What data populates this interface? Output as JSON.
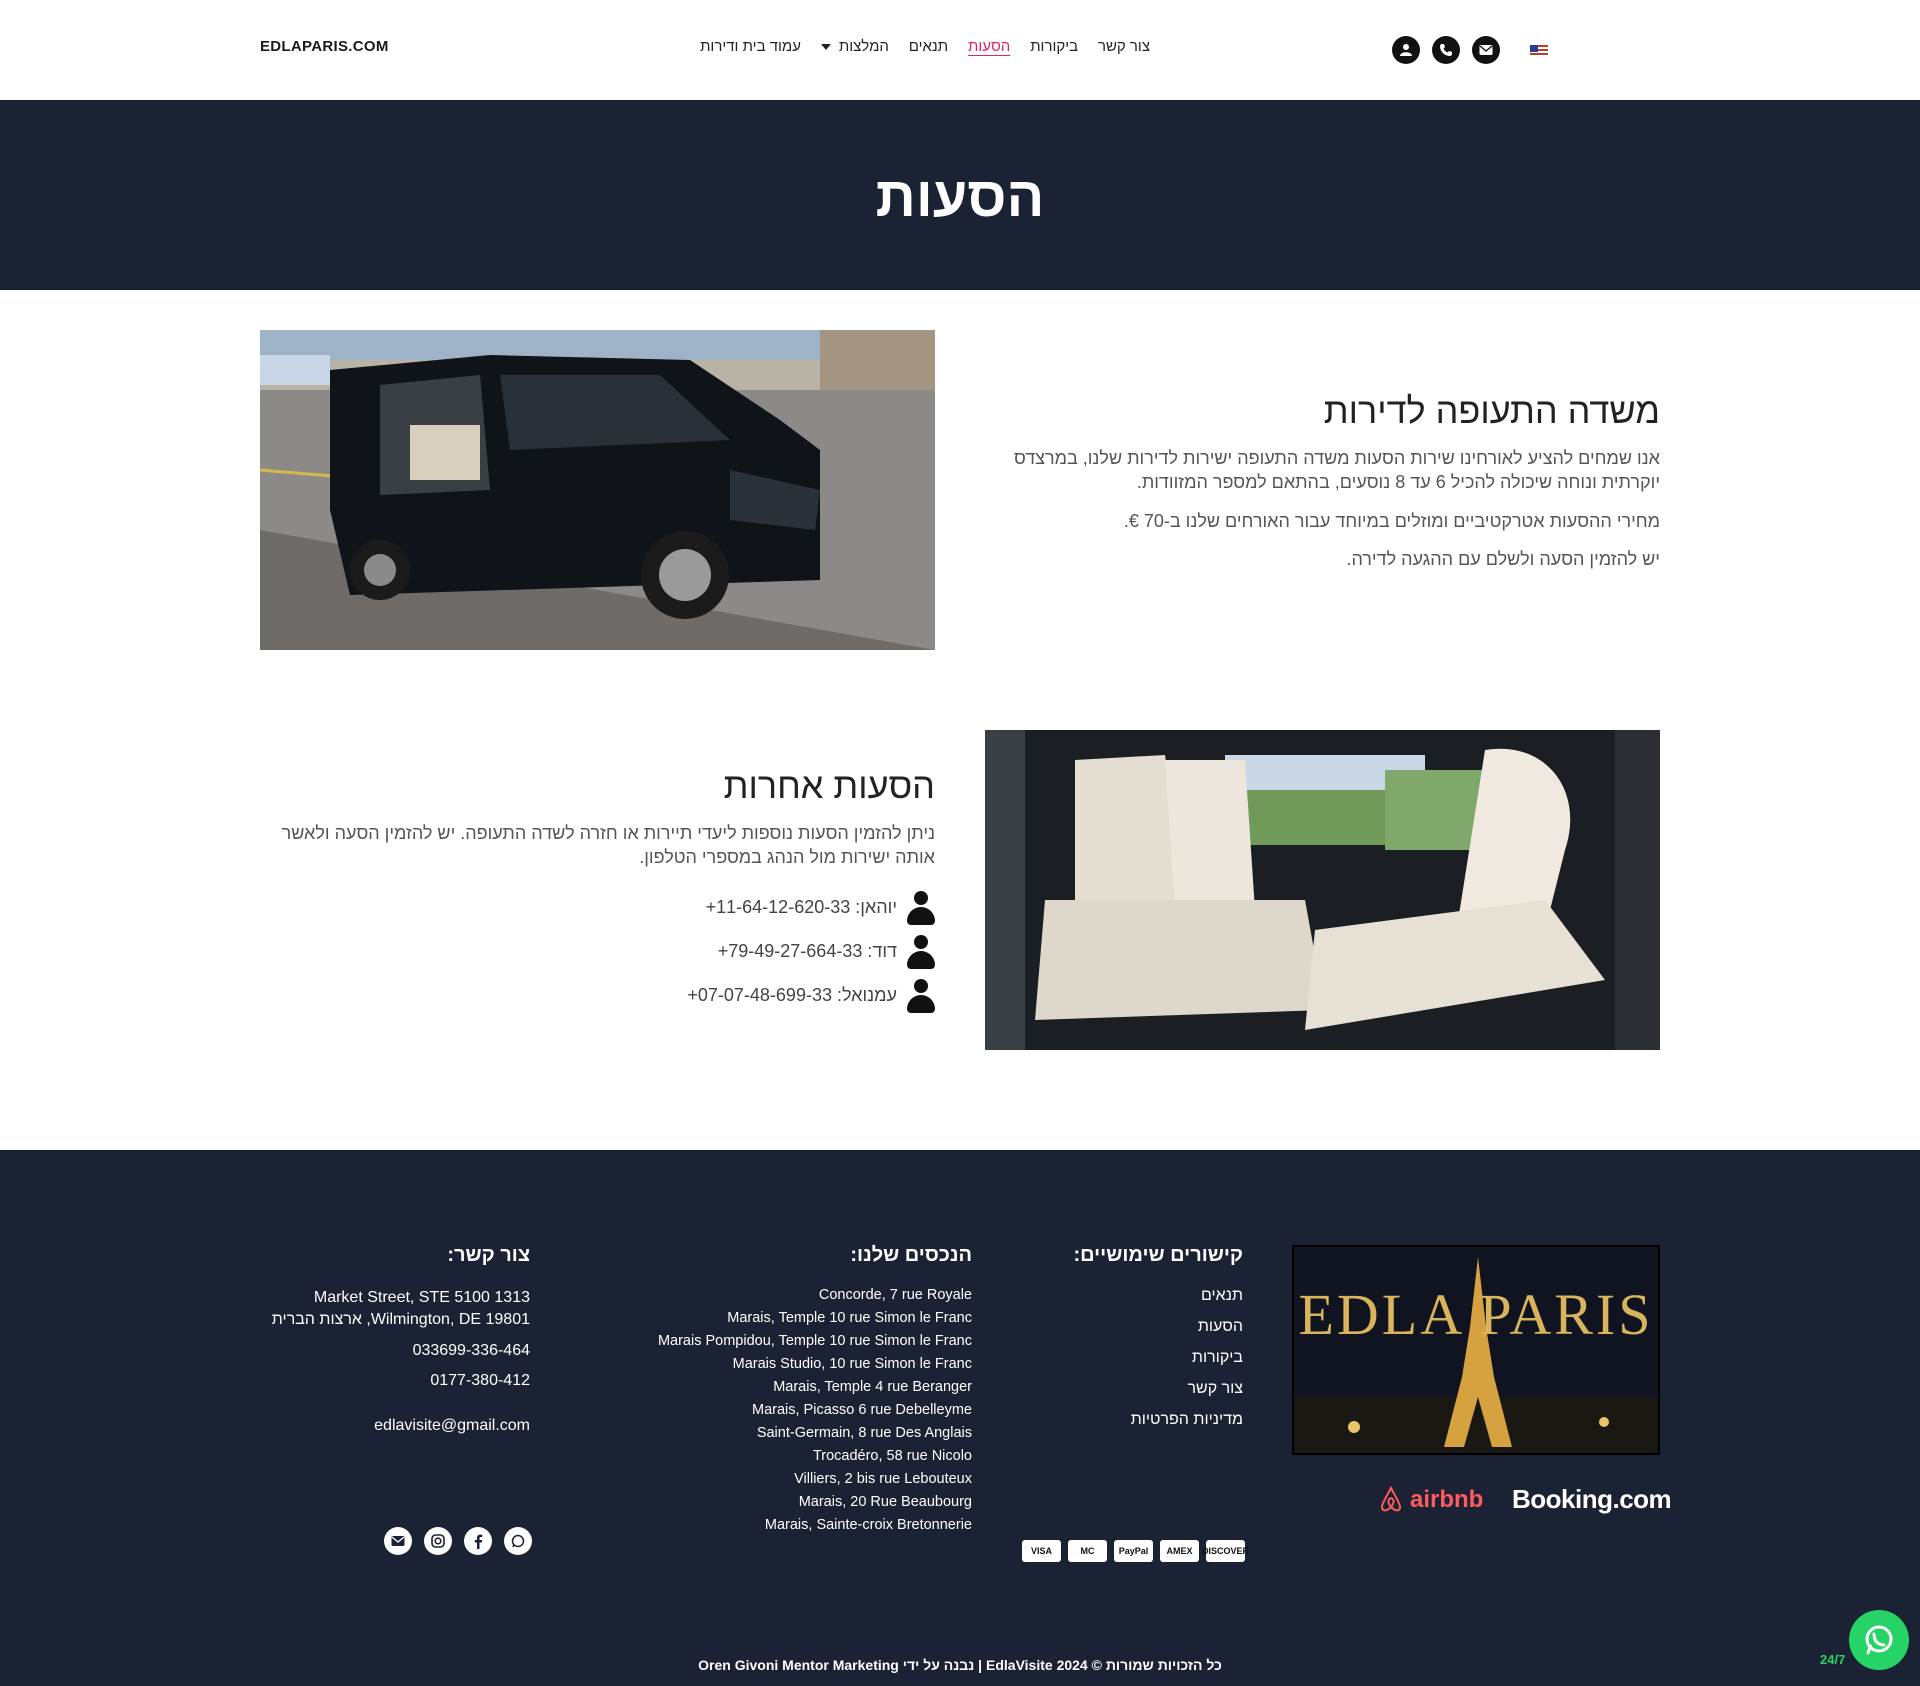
{
  "header": {
    "brand": "EDLAPARIS.COM",
    "nav": [
      {
        "label": "עמוד בית ודירות",
        "active": false,
        "dropdown": false
      },
      {
        "label": "המלצות",
        "active": false,
        "dropdown": true
      },
      {
        "label": "תנאים",
        "active": false,
        "dropdown": false
      },
      {
        "label": "הסעות",
        "active": true,
        "dropdown": false
      },
      {
        "label": "ביקורות",
        "active": false,
        "dropdown": false
      },
      {
        "label": "צור קשר",
        "active": false,
        "dropdown": false
      }
    ],
    "icons": [
      "user-icon",
      "phone-icon",
      "envelope-icon"
    ],
    "language_flag": "us-flag-icon"
  },
  "hero": {
    "title": "הסעות"
  },
  "section1": {
    "title": "משדה התעופה לדירות",
    "paragraphs": [
      "אנו שמחים להציע לאורחינו שירות הסעות משדה התעופה ישירות לדירות שלנו, במרצדס יוקרתית ונוחה שיכולה להכיל 6 עד 8 נוסעים, בהתאם למספר המזוודות.",
      "מחירי ההסעות אטרקטיביים ומוזלים במיוחד עבור האורחים שלנו ב-70 €.",
      "יש להזמין הסעה ולשלם עם ההגעה לדירה."
    ]
  },
  "section2": {
    "title": "הסעות אחרות",
    "paragraph": "ניתן להזמין הסעות נוספות ליעדי תיירות או חזרה לשדה התעופה. יש להזמין הסעה ולאשר אותה ישירות מול הנהג במספרי הטלפון.",
    "drivers": [
      "יוהאן: 11-64-12-620-33+",
      "דוד: 79-49-27-664-33+",
      "עמנואל: 07-07-48-699-33+"
    ]
  },
  "footer": {
    "links_title": "קישורים שימושיים:",
    "links": [
      "תנאים",
      "הסעות",
      "ביקורות",
      "צור קשר",
      "מדיניות הפרטיות"
    ],
    "properties_title": "הנכסים שלנו:",
    "properties": [
      "Concorde, 7 rue Royale",
      "Marais, Temple 10 rue Simon le Franc",
      "Marais Pompidou, Temple 10 rue Simon le Franc",
      "Marais Studio, 10 rue Simon le Franc",
      "Marais, Temple 4 rue Beranger",
      "Marais, Picasso 6 rue Debelleyme",
      "Saint-Germain, 8 rue Des Anglais",
      "Trocadéro, 58 rue Nicolo",
      "Villiers, 2 bis rue Lebouteux",
      "Marais, 20 Rue Beaubourg",
      "Marais, Sainte-croix Bretonnerie"
    ],
    "contact_title": "צור קשר:",
    "address_line1": "1313 Market Street, STE 5100",
    "address_line2": "Wilmington, DE 19801, ארצות הברית",
    "phone1": "033699-336-464",
    "phone2": "0177-380-412",
    "email": "edlavisite@gmail.com",
    "logo_text": "EDLA PARIS",
    "partners": {
      "airbnb": "airbnb",
      "booking": "Booking.com"
    },
    "cards": [
      "VISA",
      "MC",
      "PayPal",
      "AMEX",
      "DISCOVER"
    ],
    "socials": [
      "envelope-icon",
      "instagram-icon",
      "facebook-icon",
      "whatsapp-icon"
    ],
    "copyright": "כל הזכויות שמורות © 2024 EdlaVisite | נבנה על ידי Oren Givoni Mentor Marketing"
  },
  "whatsapp_widget": {
    "label": "24/7"
  }
}
